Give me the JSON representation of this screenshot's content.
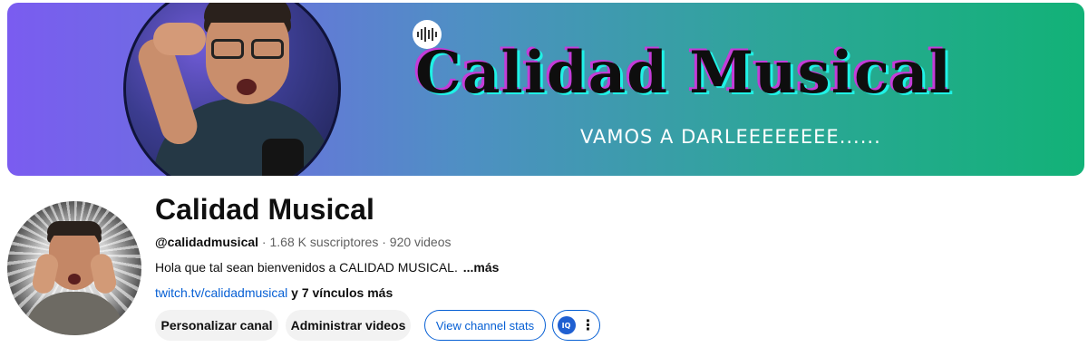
{
  "banner": {
    "title": "Calidad Musical",
    "tagline": "VAMOS A DARLEEEEEEEE......",
    "logo_icon": "audio-wave-icon"
  },
  "channel": {
    "name": "Calidad Musical",
    "handle": "@calidadmusical",
    "subscribers": "1.68 K suscriptores",
    "videos": "920 videos",
    "separator": "·",
    "description": "Hola que tal sean bienvenidos a CALIDAD MUSICAL.",
    "description_more": "...más",
    "link": "twitch.tv/calidadmusical",
    "links_extra": "y 7 vínculos más"
  },
  "actions": {
    "customize_label": "Personalizar canal",
    "manage_label": "Administrar videos",
    "stats_label": "View channel stats",
    "extension_icon_text": "IQ",
    "more_icon": "kebab-menu-icon"
  },
  "colors": {
    "link": "#065fd4",
    "banner_start": "#7a5cf0",
    "banner_end": "#12b277"
  }
}
